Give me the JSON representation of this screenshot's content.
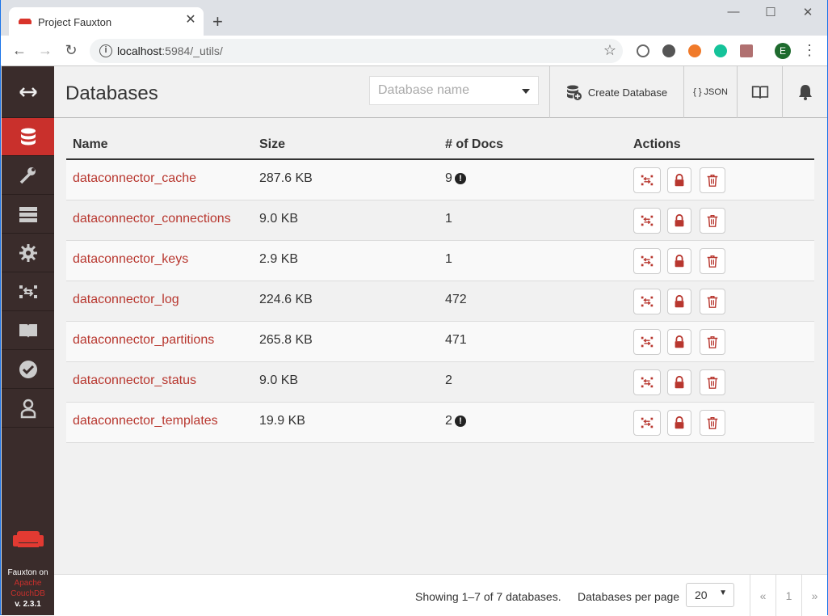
{
  "browser": {
    "tab_title": "Project Fauxton",
    "url_host": "localhost",
    "url_rest": ":5984/_utils/",
    "profile_initial": "E"
  },
  "header": {
    "title": "Databases",
    "search_placeholder": "Database name",
    "create_label": "Create Database",
    "json_label": "{ } JSON"
  },
  "table": {
    "columns": [
      "Name",
      "Size",
      "# of Docs",
      "Actions"
    ],
    "rows": [
      {
        "name": "dataconnector_cache",
        "size": "287.6 KB",
        "docs": "9",
        "warn": true
      },
      {
        "name": "dataconnector_connections",
        "size": "9.0 KB",
        "docs": "1",
        "warn": false
      },
      {
        "name": "dataconnector_keys",
        "size": "2.9 KB",
        "docs": "1",
        "warn": false
      },
      {
        "name": "dataconnector_log",
        "size": "224.6 KB",
        "docs": "472",
        "warn": false
      },
      {
        "name": "dataconnector_partitions",
        "size": "265.8 KB",
        "docs": "471",
        "warn": false
      },
      {
        "name": "dataconnector_status",
        "size": "9.0 KB",
        "docs": "2",
        "warn": false
      },
      {
        "name": "dataconnector_templates",
        "size": "19.9 KB",
        "docs": "2",
        "warn": true
      }
    ]
  },
  "footer": {
    "showing": "Showing 1–7 of 7 databases.",
    "per_page_label": "Databases per page",
    "per_page_value": "20",
    "prev": "«",
    "page": "1",
    "next": "»"
  },
  "sidebar": {
    "foot_line1": "Fauxton on",
    "foot_line2": "Apache",
    "foot_line3": "CouchDB",
    "version": "v. 2.3.1"
  },
  "colors": {
    "accent": "#c9302c",
    "sidebar": "#3a2c2b",
    "link": "#b8372f"
  }
}
